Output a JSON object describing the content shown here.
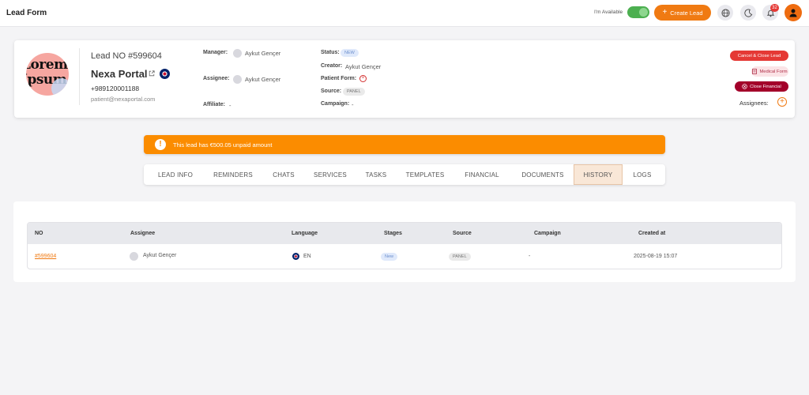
{
  "app": {
    "title": "Lead Form"
  },
  "topbar": {
    "availability_label": "I'm Available",
    "availability_on": true,
    "create_lead_label": "Create Lead",
    "notification_count": "32"
  },
  "lead": {
    "avatar_text_line1": "Lorem",
    "avatar_text_line2": "Ipsum",
    "number": "Lead NO #599604",
    "name": "Nexa Portal",
    "phone": "+989120001188",
    "email": "patient@nexaportal.com",
    "manager_label": "Manager:",
    "manager": "Aykut Gençer",
    "assignee_label": "Assignee:",
    "assignee": "Aykut Gençer",
    "affiliate_label": "Affiliate:",
    "affiliate": "-",
    "status_label": "Status:",
    "status": "NEW",
    "creator_label": "Creator:",
    "creator": "Aykut Gençer",
    "patient_form_label": "Patient Form:",
    "source_label": "Source:",
    "source": "PANEL",
    "campaign_label": "Campaign:",
    "campaign": "-"
  },
  "actions": {
    "cancel_close": "Cancel & Close Lead",
    "medical_form": "Medical Form",
    "close_financial": "Close Financial",
    "assignees_label": "Assignees:"
  },
  "alert": {
    "text": "This lead has €500.05 unpaid amount"
  },
  "tabs": [
    {
      "label": "LEAD INFO"
    },
    {
      "label": "REMINDERS"
    },
    {
      "label": "CHATS"
    },
    {
      "label": "SERVICES"
    },
    {
      "label": "TASKS"
    },
    {
      "label": "TEMPLATES"
    },
    {
      "label": "FINANCIAL"
    },
    {
      "label": "DOCUMENTS"
    },
    {
      "label": "HISTORY"
    },
    {
      "label": "LOGS"
    }
  ],
  "active_tab": "HISTORY",
  "history": {
    "columns": [
      "NO",
      "Assignee",
      "Language",
      "Stages",
      "Source",
      "Campaign",
      "Created at"
    ],
    "rows": [
      {
        "no": "#599604",
        "assignee": "Aykut Gençer",
        "language": "EN",
        "stage": "New",
        "source": "PANEL",
        "campaign": "-",
        "created_at": "2025-08-19 15:07"
      }
    ]
  },
  "colors": {
    "accent": "#f07a12",
    "alert": "#fb8c00",
    "danger": "#e53935",
    "dark_red": "#a3002a"
  }
}
